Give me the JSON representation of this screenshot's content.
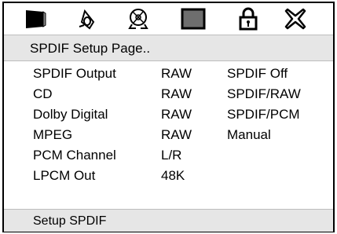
{
  "icons": [
    {
      "name": "tv-screen-icon"
    },
    {
      "name": "speaker-icon"
    },
    {
      "name": "disc-icon"
    },
    {
      "name": "square-icon"
    },
    {
      "name": "lock-icon"
    },
    {
      "name": "exit-x-icon"
    }
  ],
  "title": "SPDIF Setup Page..",
  "rows": [
    {
      "label": "SPDIF Output",
      "value": "RAW",
      "option": "SPDIF Off"
    },
    {
      "label": "CD",
      "value": "RAW",
      "option": "SPDIF/RAW"
    },
    {
      "label": "Dolby Digital",
      "value": "RAW",
      "option": "SPDIF/PCM"
    },
    {
      "label": "MPEG",
      "value": "RAW",
      "option": "Manual"
    },
    {
      "label": "PCM Channel",
      "value": "L/R",
      "option": ""
    },
    {
      "label": "LPCM Out",
      "value": "48K",
      "option": ""
    }
  ],
  "status": "Setup SPDIF"
}
